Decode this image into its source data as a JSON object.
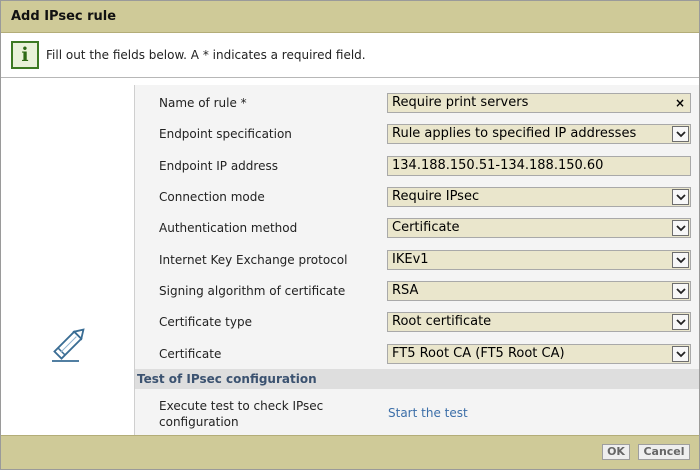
{
  "dialog": {
    "title": "Add IPsec rule",
    "info_text": "Fill out the fields below. A * indicates a required field.",
    "info_icon": "i"
  },
  "form": {
    "fields": [
      {
        "label": "Name of rule *",
        "value": "Require print servers",
        "kind": "text-clear"
      },
      {
        "label": "Endpoint specification",
        "value": "Rule applies to specified IP addresses",
        "kind": "select"
      },
      {
        "label": "Endpoint IP address",
        "value": "134.188.150.51-134.188.150.60",
        "kind": "text"
      },
      {
        "label": "Connection mode",
        "value": "Require IPsec",
        "kind": "select"
      },
      {
        "label": "Authentication method",
        "value": "Certificate",
        "kind": "select"
      },
      {
        "label": "Internet Key Exchange protocol",
        "value": "IKEv1",
        "kind": "select"
      },
      {
        "label": "Signing algorithm of certificate",
        "value": "RSA",
        "kind": "select"
      },
      {
        "label": "Certificate type",
        "value": "Root certificate",
        "kind": "select"
      },
      {
        "label": "Certificate",
        "value": "FT5 Root CA (FT5 Root CA)",
        "kind": "select"
      }
    ]
  },
  "test_section": {
    "header": "Test of IPsec configuration",
    "label_line1": "Execute test to check IPsec",
    "label_line2": "configuration",
    "link": "Start the test"
  },
  "footer": {
    "ok_label": "OK",
    "cancel_label": "Cancel"
  },
  "colors": {
    "title_bar": "#cfca98",
    "field_bg": "#eae6cc",
    "section_header_text": "#3b5270",
    "link": "#3b6ea8"
  }
}
